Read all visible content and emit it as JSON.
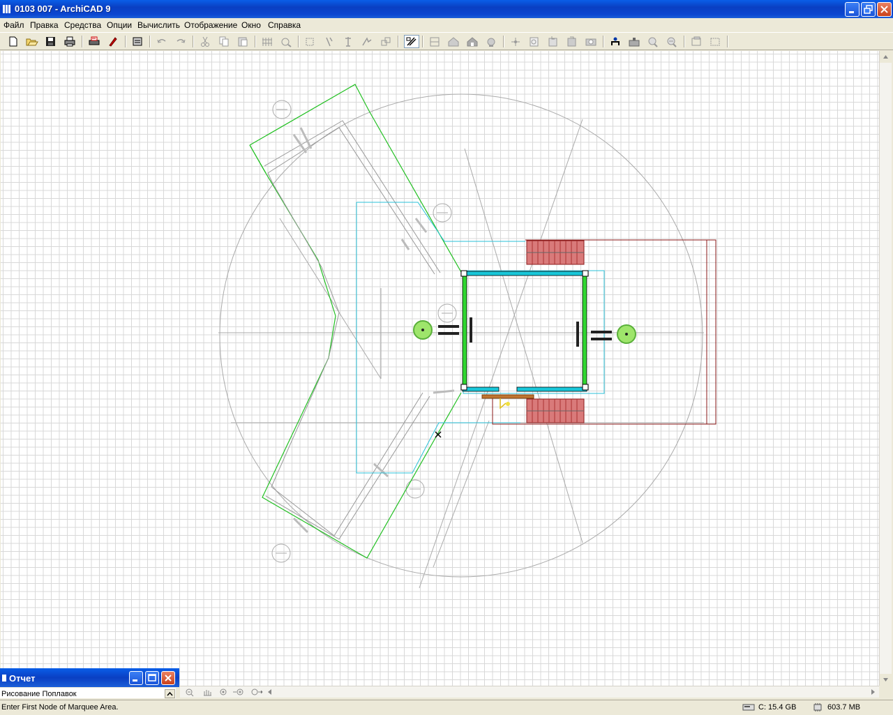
{
  "window": {
    "title": "0103 007 - ArchiCAD 9"
  },
  "menu": [
    "Файл",
    "Правка",
    "Средства",
    "Опции",
    "Вычислить",
    "Отображение",
    "Окно",
    "Справка"
  ],
  "toolbar": {
    "buttons": [
      "new-icon",
      "open-icon",
      "save-icon",
      "print-icon",
      "plot-icon",
      "pen-icon",
      "publish-icon",
      "undo-icon",
      "redo-icon",
      "cut-icon",
      "copy-icon",
      "paste-icon",
      "grid-icon",
      "snap-icon",
      "select-icon",
      "drag-icon",
      "rotate-icon",
      "mirror-icon",
      "multiply-icon",
      "trace-icon",
      "section-icon",
      "elevation-icon",
      "3d-icon",
      "render-icon",
      "measure-icon",
      "ruler-icon",
      "sun-icon",
      "camera-icon",
      "library-icon",
      "object-icon",
      "zoom-icon",
      "zoom-out-icon",
      "fit-icon",
      "window-icon"
    ]
  },
  "report": {
    "title": "Отчет",
    "text": "Рисование  Поплавок"
  },
  "status": {
    "message": "Enter First Node of Marquee Area.",
    "disk": "C: 15.4 GB",
    "memory": "603.7 MB"
  },
  "colors": {
    "titlebar": "#0a46d1",
    "wall": "#2fd62f",
    "beam": "#18c6d8",
    "stair": "#c43c3c"
  }
}
